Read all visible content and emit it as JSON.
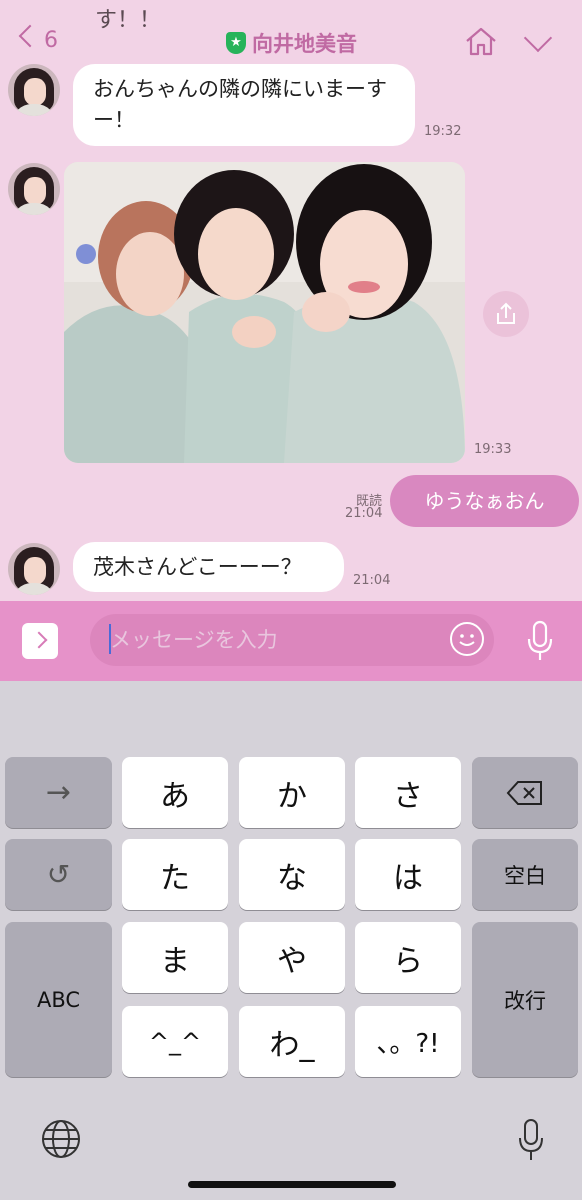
{
  "header": {
    "partial_text_line1": "",
    "partial_text_line2": "す！！",
    "back_count": "6",
    "title": "向井地美音"
  },
  "messages": [
    {
      "type": "text",
      "side": "left",
      "text": "おんちゃんの隣の隣にいまーすー！",
      "time": "19:32"
    },
    {
      "type": "image",
      "side": "left",
      "time": "19:33"
    },
    {
      "type": "text",
      "side": "right",
      "text": "ゆうなぁおん",
      "read_label": "既読",
      "time": "21:04"
    },
    {
      "type": "text",
      "side": "left",
      "text": "茂木さんどこーーー？",
      "time": "21:04"
    }
  ],
  "input": {
    "placeholder": "メッセージを入力"
  },
  "keyboard": {
    "left_col": [
      "→",
      "↺",
      "ABC"
    ],
    "kana": [
      "あ",
      "か",
      "さ",
      "た",
      "な",
      "は",
      "ま",
      "や",
      "ら",
      "^_^",
      "わ_",
      "、。?!"
    ],
    "right_col": [
      "⌫",
      "空白",
      "改行"
    ]
  },
  "colors": {
    "chat_bg": "#f2d3e6",
    "accent": "#c06aa3",
    "sent_bubble": "#d988c0",
    "input_bar": "#e692c9"
  }
}
